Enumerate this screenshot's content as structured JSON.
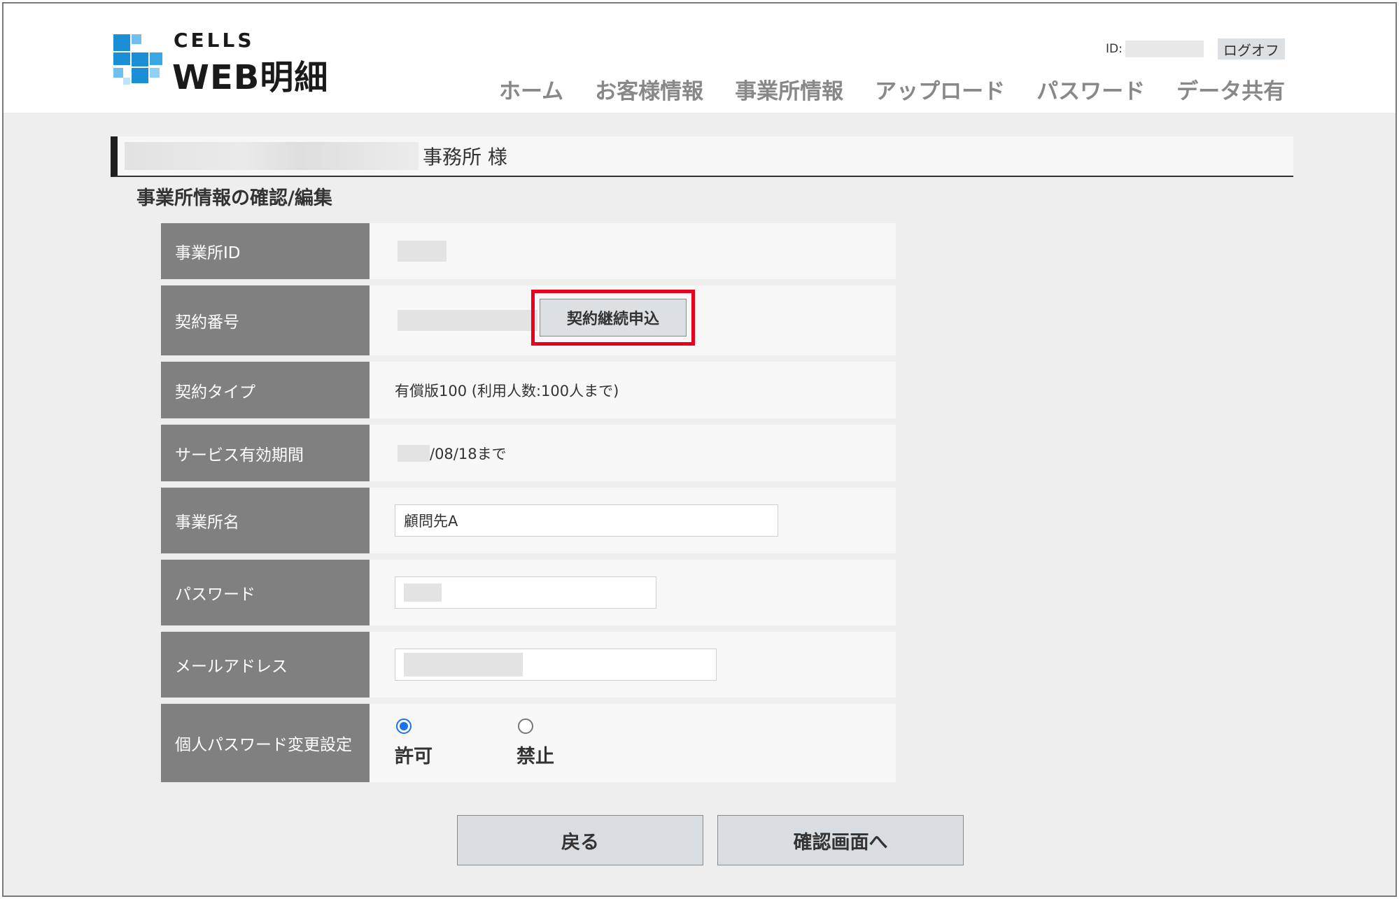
{
  "header": {
    "logo_top": "CELLS",
    "logo_main": "WEB明細",
    "id_label": "ID:",
    "logoff_label": "ログオフ",
    "nav": [
      "ホーム",
      "お客様情報",
      "事業所情報",
      "アップロード",
      "パスワード",
      "データ共有"
    ]
  },
  "office": {
    "name_suffix": "事務所 様"
  },
  "section_title": "事業所情報の確認/編集",
  "form": {
    "office_id_label": "事業所ID",
    "contract_number_label": "契約番号",
    "renew_button": "契約継続申込",
    "contract_type_label": "契約タイプ",
    "contract_type_value": "有償版100 (利用人数:100人まで)",
    "service_period_label": "サービス有効期間",
    "service_period_value": "/08/18まで",
    "office_name_label": "事業所名",
    "office_name_value": "顧問先A",
    "password_label": "パスワード",
    "email_label": "メールアドレス",
    "password_change_label": "個人パスワード変更設定",
    "radio_allow": "許可",
    "radio_deny": "禁止",
    "selected": "許可"
  },
  "buttons": {
    "back": "戻る",
    "confirm": "確認画面へ"
  },
  "colors": {
    "highlight": "#e8001c",
    "label_bg": "#808080",
    "radio_checked": "#1a73e8",
    "logo_blue": "#1a8fd6"
  }
}
